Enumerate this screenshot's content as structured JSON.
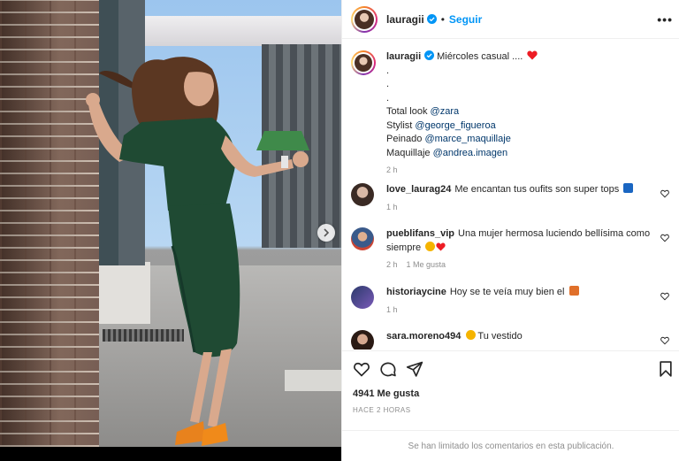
{
  "post": {
    "username": "lauragii",
    "follow_label": "Seguir",
    "more_label": "•••",
    "caption": {
      "username": "lauragii",
      "text": "Miércoles casual ....",
      "dots": [
        ".",
        ".",
        "."
      ],
      "credits": [
        {
          "label": "Total look",
          "mention": "@zara"
        },
        {
          "label": "Stylist",
          "mention": "@george_figueroa"
        },
        {
          "label": "Peinado",
          "mention": "@marce_maquillaje"
        },
        {
          "label": "Maquillaje",
          "mention": "@andrea.imagen"
        }
      ],
      "time": "2 h"
    },
    "comments": [
      {
        "username": "love_laurag24",
        "text": "Me encantan tus oufits son super tops",
        "time": "1 h",
        "likes": ""
      },
      {
        "username": "pueblifans_vip",
        "text": "Una mujer hermosa luciendo bellísima como siempre",
        "time": "2 h",
        "likes": "1 Me gusta"
      },
      {
        "username": "historiaycine",
        "text": "Hoy se te veía muy bien el",
        "time": "1 h",
        "likes": ""
      },
      {
        "username": "sara.moreno494",
        "text": "Tu vestido",
        "time": "",
        "likes": ""
      }
    ],
    "likes_count": "4941 Me gusta",
    "posted_ago": "HACE 2 HORAS",
    "comments_limited": "Se han limitado los comentarios en esta publicación."
  },
  "colors": {
    "follow_blue": "#0095f6",
    "mention_blue": "#00376b",
    "secondary_text": "#8e8e8e",
    "heart_red": "#ed1c24",
    "dress_green": "#1f4a33"
  },
  "icons": [
    "verified-badge-icon",
    "more-options-icon",
    "heart-icon",
    "comment-icon",
    "share-icon",
    "bookmark-icon",
    "next-arrow-icon"
  ]
}
